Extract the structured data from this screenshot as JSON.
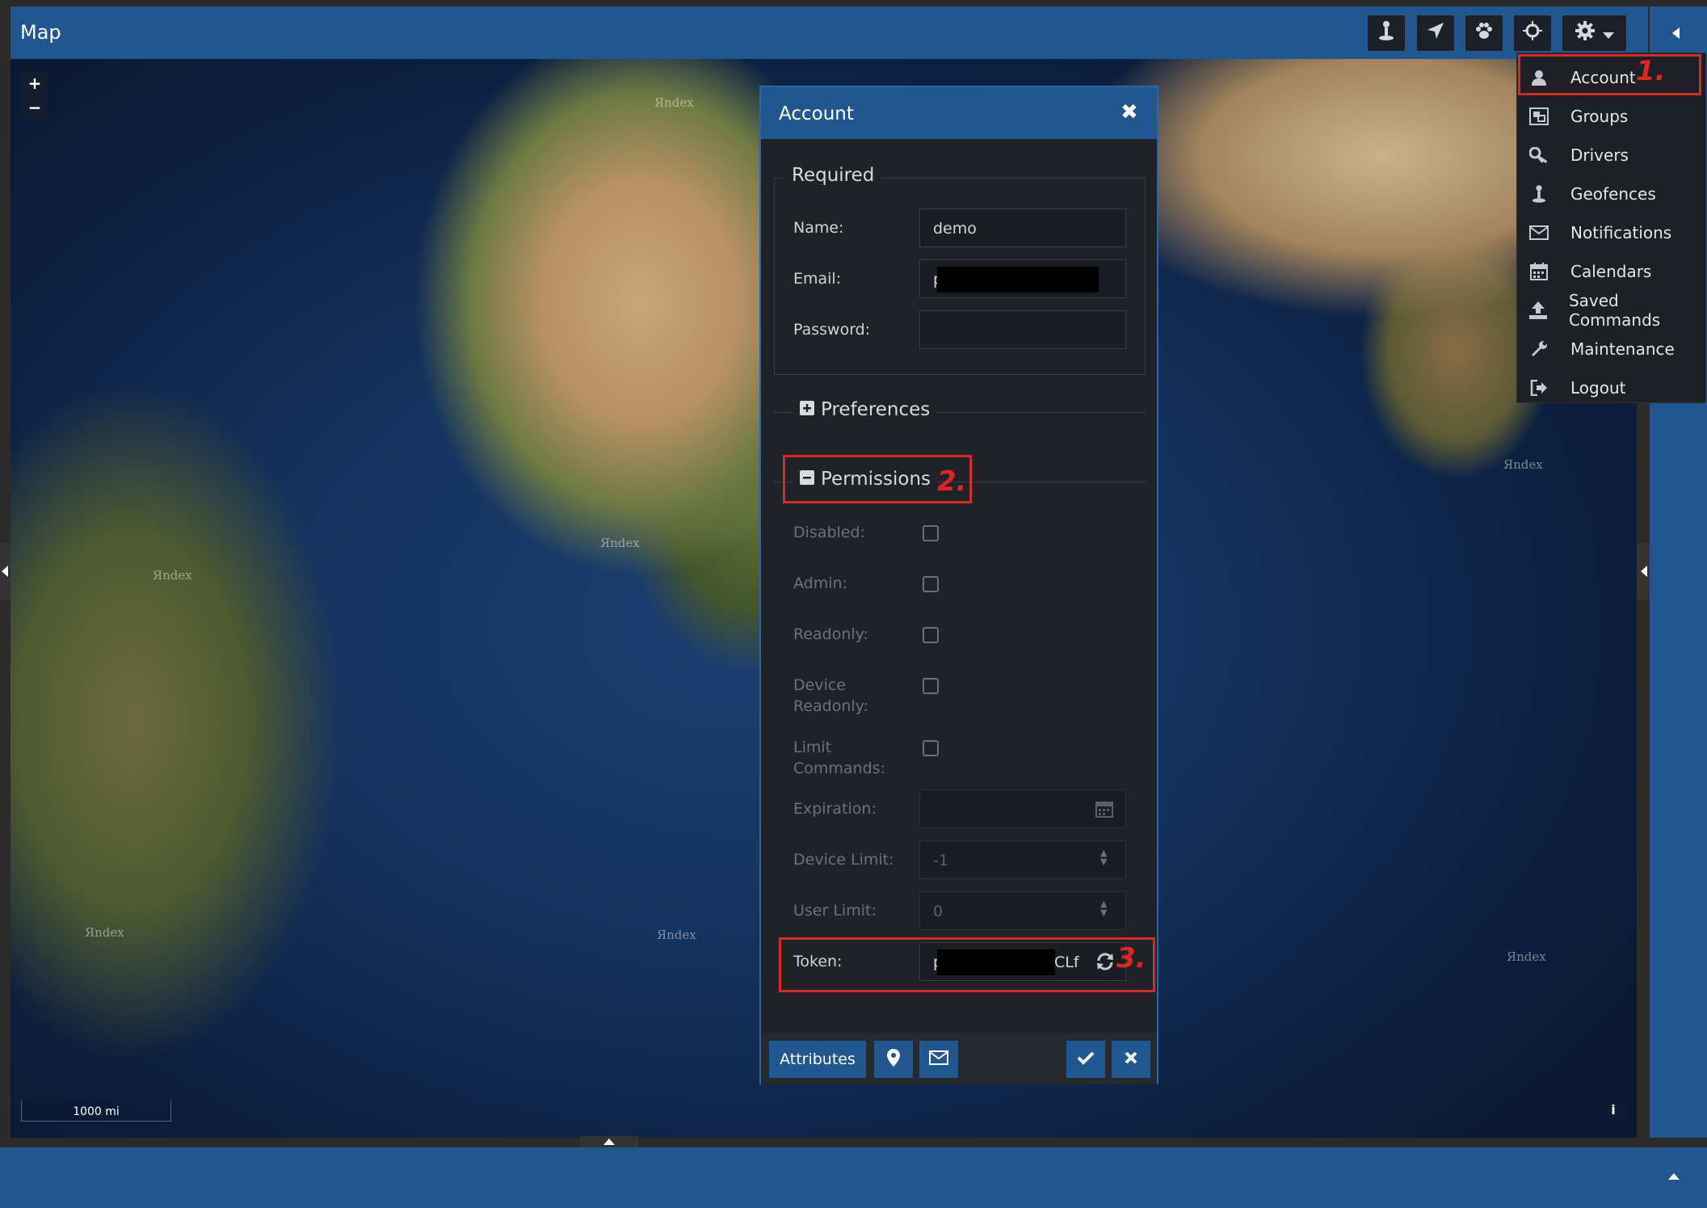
{
  "header": {
    "title": "Map"
  },
  "toolbar": {
    "buttons": [
      {
        "name": "geofence-tool-button",
        "icon": "map-pin-person-icon"
      },
      {
        "name": "navigate-button",
        "icon": "location-arrow-icon"
      },
      {
        "name": "follow-button",
        "icon": "paw-icon"
      },
      {
        "name": "center-button",
        "icon": "crosshair-icon"
      },
      {
        "name": "settings-button",
        "icon": "gear-icon"
      }
    ]
  },
  "menu": {
    "items": [
      {
        "label": "Account",
        "icon": "user-icon"
      },
      {
        "label": "Groups",
        "icon": "groups-icon"
      },
      {
        "label": "Drivers",
        "icon": "key-icon"
      },
      {
        "label": "Geofences",
        "icon": "map-pin-person-icon"
      },
      {
        "label": "Notifications",
        "icon": "envelope-icon"
      },
      {
        "label": "Calendars",
        "icon": "calendar-icon"
      },
      {
        "label": "Saved Commands",
        "icon": "upload-icon"
      },
      {
        "label": "Maintenance",
        "icon": "wrench-icon"
      },
      {
        "label": "Logout",
        "icon": "sign-out-icon"
      }
    ]
  },
  "dialog": {
    "title": "Account",
    "required": {
      "legend": "Required",
      "name_label": "Name:",
      "name_value": "demo",
      "email_label": "Email:",
      "email_value": "p",
      "password_label": "Password:",
      "password_value": ""
    },
    "preferences": {
      "legend": "Preferences"
    },
    "permissions": {
      "legend": "Permissions",
      "disabled_label": "Disabled:",
      "admin_label": "Admin:",
      "readonly_label": "Readonly:",
      "device_readonly_label_1": "Device",
      "device_readonly_label_2": "Readonly:",
      "limit_commands_label_1": "Limit",
      "limit_commands_label_2": "Commands:",
      "expiration_label": "Expiration:",
      "expiration_value": "",
      "device_limit_label": "Device Limit:",
      "device_limit_value": "-1",
      "user_limit_label": "User Limit:",
      "user_limit_value": "0",
      "token_label": "Token:",
      "token_value_start": "p",
      "token_value_end": "CLf"
    },
    "footer": {
      "attributes_label": "Attributes"
    }
  },
  "map": {
    "labels": [
      "Яndex",
      "Яndex",
      "Яndex",
      "Яndex",
      "Яndex",
      "Яndex",
      "Яndex"
    ],
    "scale": "1000 mi",
    "info": "i",
    "zoom_in": "+",
    "zoom_out": "−"
  },
  "annotations": [
    "1.",
    "2.",
    "3."
  ]
}
